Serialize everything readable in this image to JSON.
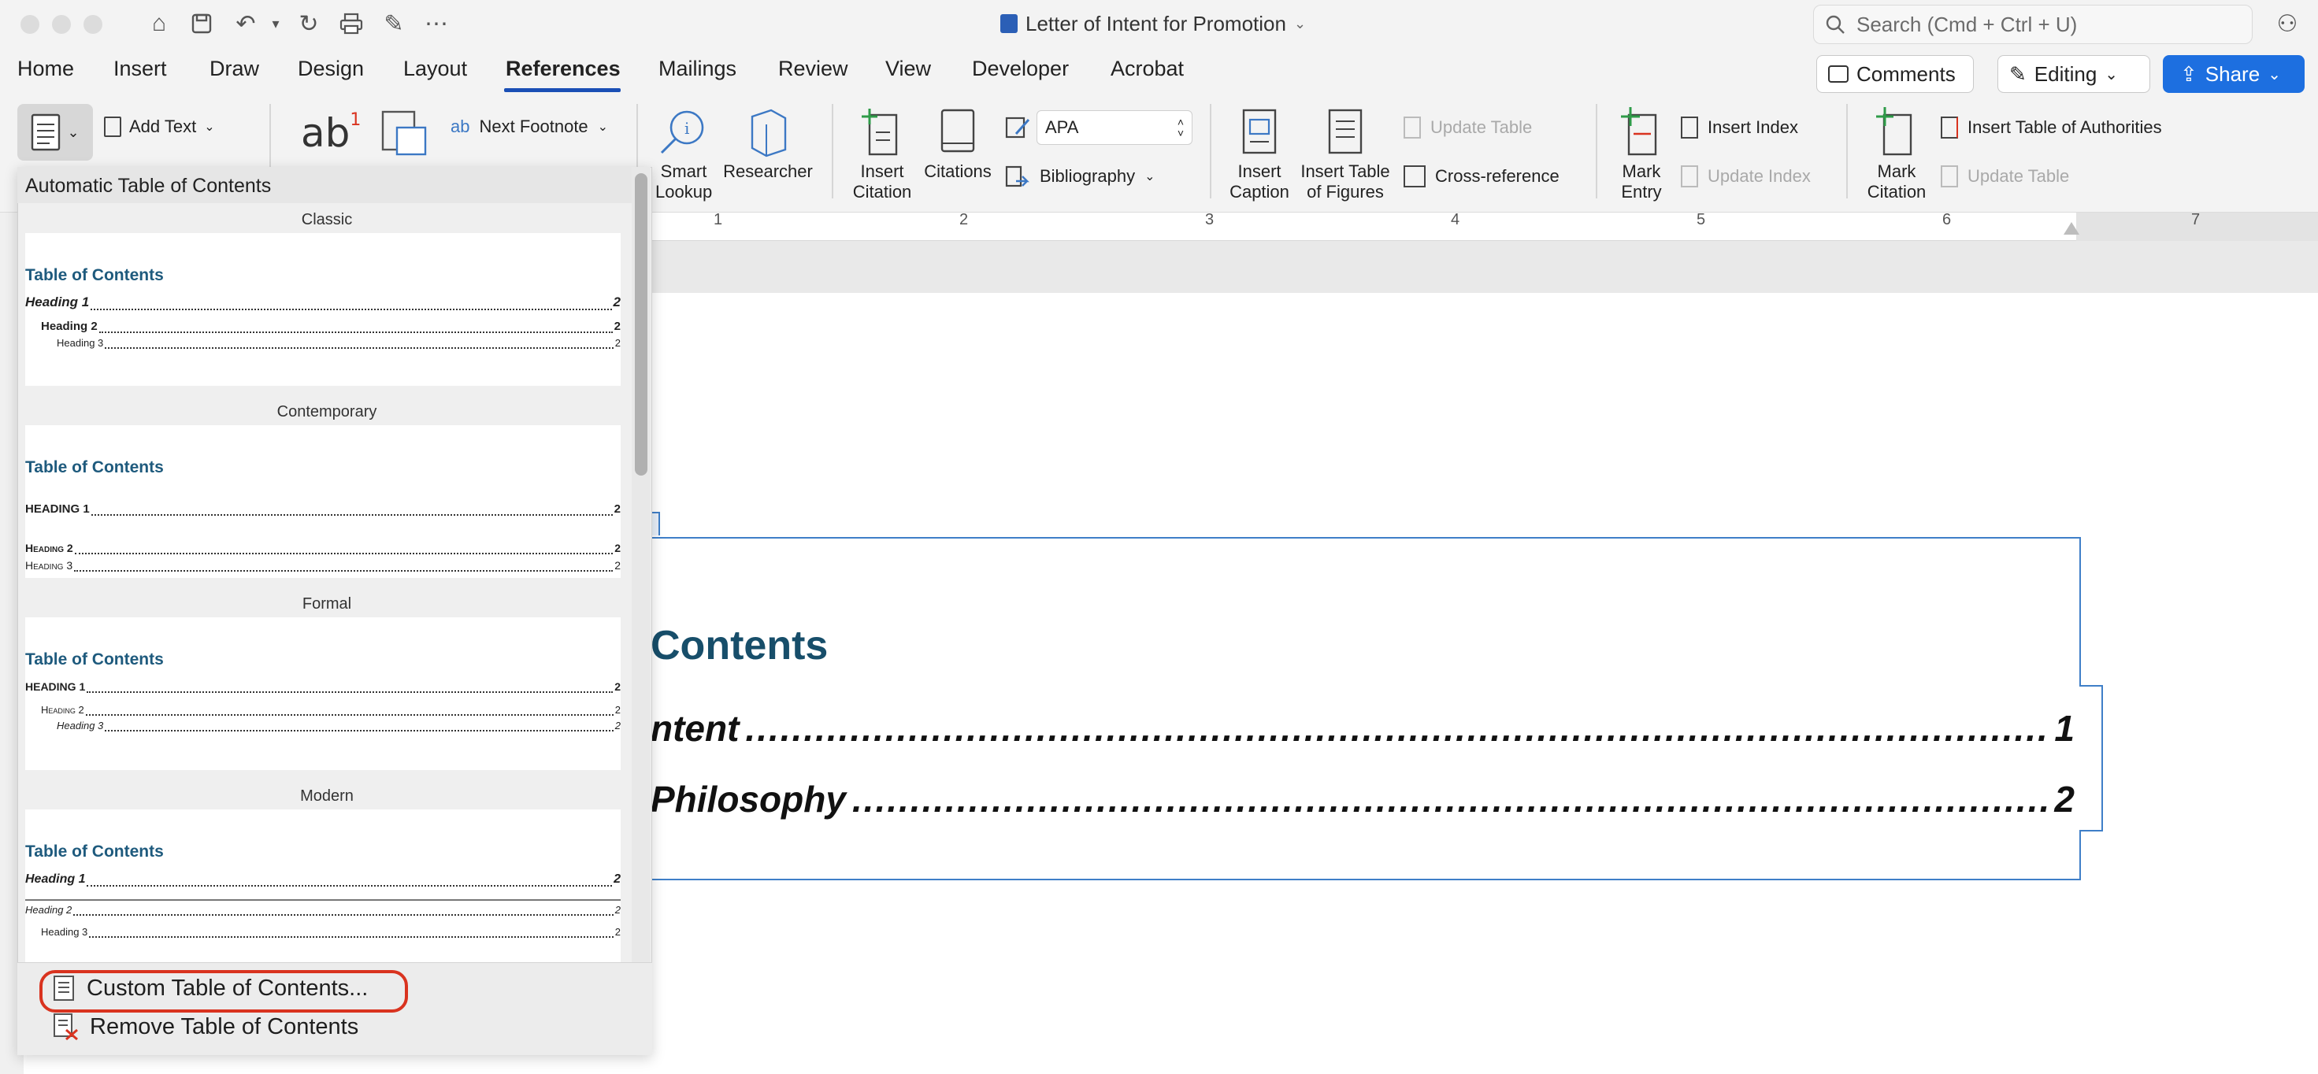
{
  "window": {
    "doc_title": "Letter of Intent for Promotion",
    "search_placeholder": "Search (Cmd + Ctrl + U)"
  },
  "tabs": [
    "Home",
    "Insert",
    "Draw",
    "Design",
    "Layout",
    "References",
    "Mailings",
    "Review",
    "View",
    "Developer",
    "Acrobat"
  ],
  "active_tab": "References",
  "top_buttons": {
    "comments": "Comments",
    "editing": "Editing",
    "share": "Share"
  },
  "ribbon": {
    "add_text": "Add Text",
    "next_footnote": "Next Footnote",
    "smart_lookup": [
      "Smart",
      "Lookup"
    ],
    "researcher": "Researcher",
    "insert_citation": [
      "Insert",
      "Citation"
    ],
    "citations": "Citations",
    "style_value": "APA",
    "bibliography": "Bibliography",
    "insert_caption": [
      "Insert",
      "Caption"
    ],
    "insert_table_figures": [
      "Insert Table",
      "of Figures"
    ],
    "update_table": "Update Table",
    "cross_reference": "Cross-reference",
    "mark_entry": [
      "Mark",
      "Entry"
    ],
    "insert_index": "Insert Index",
    "update_index": "Update Index",
    "mark_citation": [
      "Mark",
      "Citation"
    ],
    "insert_table_authorities": "Insert Table of Authorities",
    "update_table_2": "Update Table",
    "footnote_glyph": "ab",
    "footnote_sup": "1"
  },
  "ruler_numbers": [
    "1",
    "2",
    "3",
    "4",
    "5",
    "6",
    "7"
  ],
  "gallery": {
    "header": "Automatic Table of Contents",
    "styles": [
      {
        "name": "Classic",
        "title": "Table of Contents",
        "h1": "Heading 1",
        "h2": "Heading 2",
        "h3": "Heading 3",
        "page": "2"
      },
      {
        "name": "Contemporary",
        "title": "Table of Contents",
        "h1": "HEADING 1",
        "h2": "Heading 2",
        "h3": "Heading 3",
        "page": "2"
      },
      {
        "name": "Formal",
        "title": "Table of Contents",
        "h1": "HEADING 1",
        "h2": "Heading 2",
        "h3": "Heading 3",
        "page": "2"
      },
      {
        "name": "Modern",
        "title": "Table of Contents",
        "h1": "Heading 1",
        "h2": "Heading 2",
        "h3": "Heading 3",
        "page": "2"
      }
    ],
    "custom": "Custom Table of Contents...",
    "remove": "Remove Table of Contents"
  },
  "document": {
    "toc_heading": "Contents",
    "entries": [
      {
        "text": "ntent",
        "page": "1"
      },
      {
        "text": "Philosophy",
        "page": "2"
      }
    ]
  },
  "colors": {
    "accent": "#1a4fb5",
    "share": "#1d6fe0",
    "highlight": "#d9331f",
    "toc_heading": "#174e6a"
  }
}
